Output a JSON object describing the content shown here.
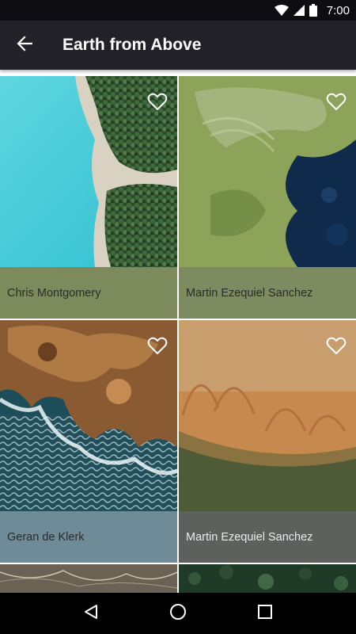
{
  "status_bar": {
    "time": "7:00",
    "icons": [
      "wifi-icon",
      "cell-signal-icon",
      "battery-icon"
    ]
  },
  "app_bar": {
    "back_icon": "arrow-back-icon",
    "title": "Earth from Above",
    "background": "#232128"
  },
  "photos": [
    {
      "author": "Chris Montgomery",
      "caption_color": "#7d8b5c",
      "caption_text_light": false,
      "scene": "lake-forest"
    },
    {
      "author": "Martin Ezequiel Sanchez",
      "caption_color": "#7e8a5f",
      "caption_text_light": false,
      "scene": "algae-water"
    },
    {
      "author": "Geran de Klerk",
      "caption_color": "#6f8b98",
      "caption_text_light": false,
      "scene": "rocky-coast"
    },
    {
      "author": "Martin Ezequiel Sanchez",
      "caption_color": "#5d605d",
      "caption_text_light": true,
      "scene": "sand-arcs"
    }
  ],
  "favorite_icon": "heart-outline-icon",
  "nav_bar": {
    "buttons": [
      "back-triangle-icon",
      "home-circle-icon",
      "recents-square-icon"
    ]
  }
}
